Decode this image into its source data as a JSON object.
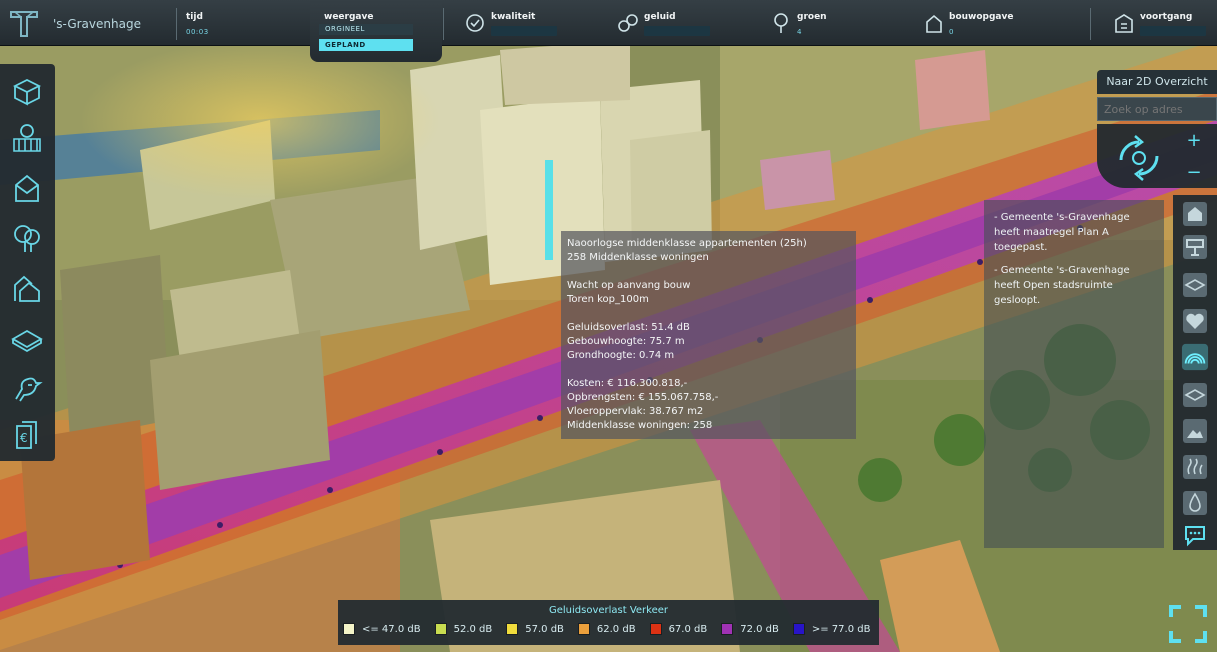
{
  "app": {
    "city": "'s-Gravenhage"
  },
  "topbar": {
    "time": {
      "label": "tijd",
      "value": "00:03"
    },
    "view": {
      "label": "weergave",
      "option_original": "ORGINEEL",
      "option_planned": "GEPLAND",
      "selected": "GEPLAND"
    },
    "indicators": [
      {
        "label": "kwaliteit",
        "value": "",
        "icon": "star-icon"
      },
      {
        "label": "geluid",
        "value": "",
        "icon": "noise-icon"
      },
      {
        "label": "groen",
        "value": "4",
        "icon": "tree-icon"
      },
      {
        "label": "bouwopgave",
        "value": "0",
        "icon": "house-icon"
      },
      {
        "label": "voortgang",
        "value": "",
        "icon": "building-icon"
      }
    ]
  },
  "left_tools": [
    {
      "name": "build-tool",
      "icon": "box-icon"
    },
    {
      "name": "demolish-tool",
      "icon": "bulldozer-icon"
    },
    {
      "name": "housing-tool",
      "icon": "house-icon"
    },
    {
      "name": "green-tool",
      "icon": "tree-icon"
    },
    {
      "name": "zoning-tool",
      "icon": "houses-icon"
    },
    {
      "name": "terrain-tool",
      "icon": "land-icon"
    },
    {
      "name": "nature-tool",
      "icon": "bird-icon"
    },
    {
      "name": "finance-tool",
      "icon": "money-icon"
    }
  ],
  "right_controls": {
    "overview_button": "Naar 2D Overzicht",
    "search_placeholder": "Zoek op adres",
    "zoom_in": "+",
    "zoom_out": "−"
  },
  "right_rail": [
    {
      "name": "home",
      "icon": "home-icon",
      "active": false
    },
    {
      "name": "sign",
      "icon": "sign-icon",
      "active": false
    },
    {
      "name": "map-layer",
      "icon": "layers-icon",
      "active": false
    },
    {
      "name": "health",
      "icon": "heart-icon",
      "active": false
    },
    {
      "name": "noise-overlay",
      "icon": "soundwave-icon",
      "active": true
    },
    {
      "name": "terrain-overlay",
      "icon": "layers-alt-icon",
      "active": false
    },
    {
      "name": "image-overlay",
      "icon": "image-icon",
      "active": false
    },
    {
      "name": "heat-overlay",
      "icon": "heat-icon",
      "active": false
    },
    {
      "name": "water-overlay",
      "icon": "water-icon",
      "active": false
    },
    {
      "name": "chat",
      "icon": "chat-icon",
      "active": false
    }
  ],
  "notifications": [
    "- Gemeente 's-Gravenhage heeft maatregel Plan A toegepast.",
    "- Gemeente 's-Gravenhage heeft Open stadsruimte gesloopt."
  ],
  "popup": {
    "title": "Naoorlogse middenklasse appartementen (25h)",
    "subtitle": "258 Middenklasse woningen",
    "status": "Wacht op aanvang bouw",
    "name": "Toren kop_100m",
    "noise": "Geluidsoverlast: 51.4 dB",
    "height": "Gebouwhoogte: 75.7 m",
    "ground": "Grondhoogte: 0.74 m",
    "costs": "Kosten: € 116.300.818,-",
    "revenue": "Opbrengsten: € 155.067.758,-",
    "floor": "Vloeroppervlak: 38.767 m2",
    "units": "Middenklasse woningen: 258"
  },
  "legend": {
    "title": "Geluidsoverlast Verkeer",
    "items": [
      {
        "label": "<= 47.0 dB",
        "color": "#f4f4c8"
      },
      {
        "label": "52.0 dB",
        "color": "#c8dc50"
      },
      {
        "label": "57.0 dB",
        "color": "#f0dc3c"
      },
      {
        "label": "62.0 dB",
        "color": "#eba03c"
      },
      {
        "label": "67.0 dB",
        "color": "#dc3214"
      },
      {
        "label": "72.0 dB",
        "color": "#a032b4"
      },
      {
        "label": ">= 77.0 dB",
        "color": "#2814c8"
      }
    ]
  },
  "colors": {
    "accent": "#5ee0f0",
    "panel": "#232b30"
  }
}
